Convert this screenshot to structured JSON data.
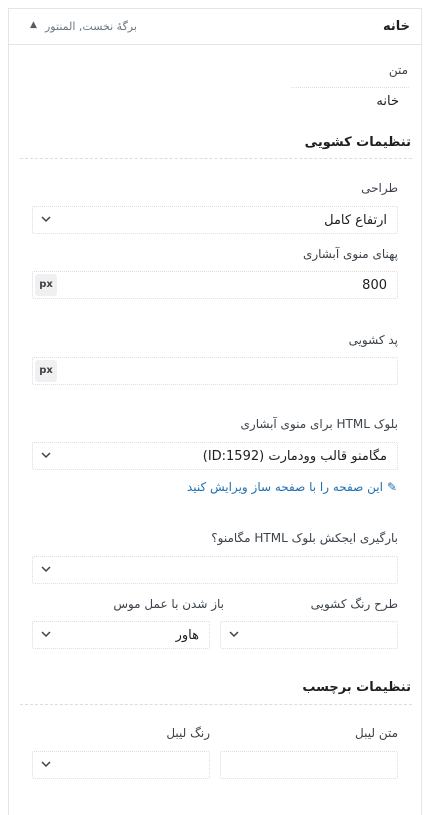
{
  "header": {
    "title": "خانه",
    "subtitle": "برگهٔ نخست, المنتور",
    "collapse_icon": "triangle-up-icon"
  },
  "text_field": {
    "label": "متن",
    "value": "خانه"
  },
  "dropdown_settings": {
    "title": "تنظیمات کشویی",
    "design": {
      "label": "طراحی",
      "value": "ارتفاع کامل"
    },
    "menu_width": {
      "label": "پهنای منوی آبشاری",
      "value": "800",
      "unit": "px"
    },
    "padding": {
      "label": "پد کشویی",
      "value": "",
      "unit": "px"
    },
    "html_block": {
      "label": "بلوک HTML برای منوی آبشاری",
      "value": "مگامنو قالب وودمارت (ID:1592)",
      "edit_link": "این صفحه را با صفحه ساز ویرایش کنید"
    },
    "ajax": {
      "label": "بارگیری ایجکش بلوک HTML مگامنو؟",
      "value": ""
    },
    "color_scheme": {
      "label": "طرح رنگ کشویی",
      "value": ""
    },
    "open_on": {
      "label": "باز شدن با عمل موس",
      "value": "هاور"
    }
  },
  "label_settings": {
    "title": "تنظیمات برچسب",
    "label_text": {
      "label": "متن لیبل",
      "value": ""
    },
    "label_color": {
      "label": "رنگ لیبل",
      "value": ""
    }
  }
}
